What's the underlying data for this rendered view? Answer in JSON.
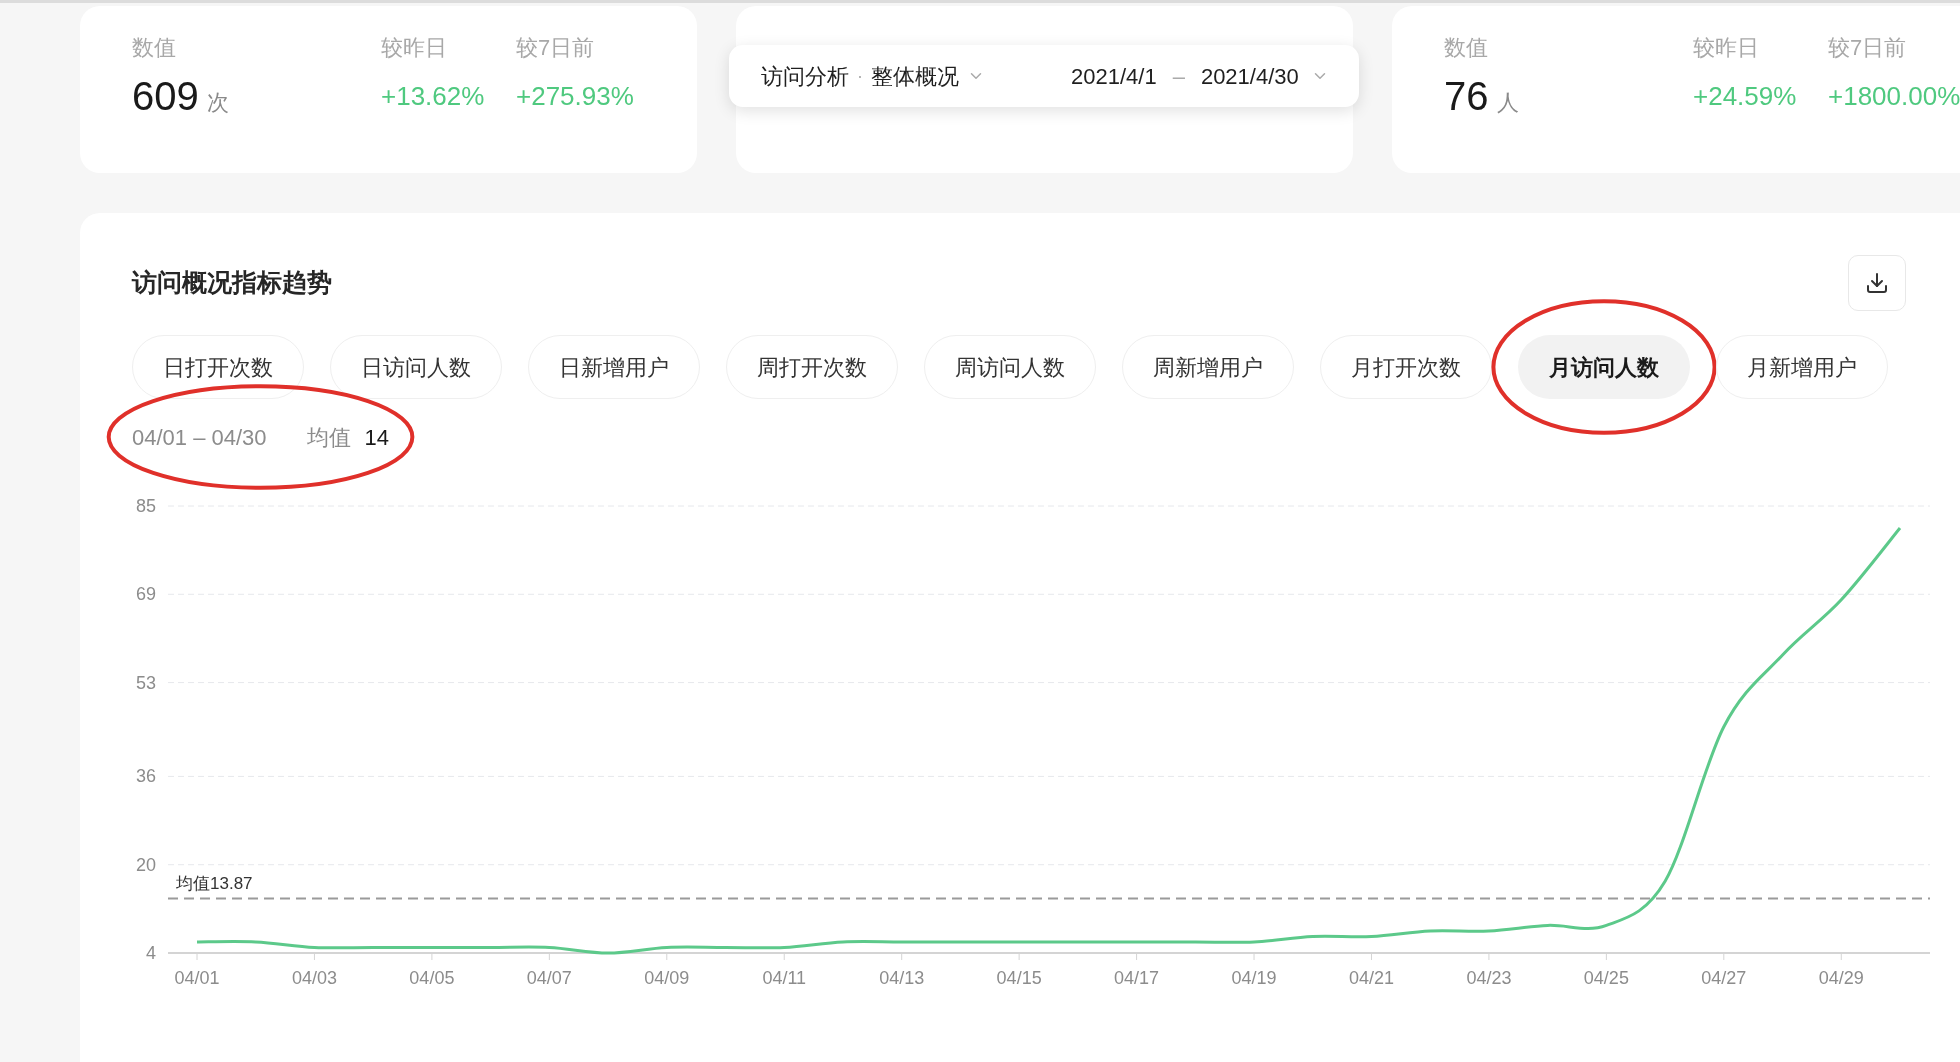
{
  "cards": [
    {
      "kind": "stat",
      "label": "数值",
      "value": "609",
      "unit": "次",
      "compare": [
        {
          "label": "较昨日",
          "value": "+13.62%"
        },
        {
          "label": "较7日前",
          "value": "+275.93%"
        }
      ]
    },
    {
      "kind": "covered"
    },
    {
      "kind": "stat",
      "label": "数值",
      "value": "76",
      "unit": "人",
      "compare": [
        {
          "label": "较昨日",
          "value": "+24.59%"
        },
        {
          "label": "较7日前",
          "value": "+1800.00%"
        }
      ]
    }
  ],
  "filter_bar": {
    "breadcrumb": [
      "访问分析",
      "整体概况"
    ],
    "breadcrumb_sep": "·",
    "date_start": "2021/4/1",
    "date_sep": "–",
    "date_end": "2021/4/30"
  },
  "trend": {
    "title": "访问概况指标趋势",
    "tabs": [
      {
        "label": "日打开次数",
        "selected": false,
        "circled": false
      },
      {
        "label": "日访问人数",
        "selected": false,
        "circled": false
      },
      {
        "label": "日新增用户",
        "selected": false,
        "circled": false
      },
      {
        "label": "周打开次数",
        "selected": false,
        "circled": false
      },
      {
        "label": "周访问人数",
        "selected": false,
        "circled": false
      },
      {
        "label": "周新增用户",
        "selected": false,
        "circled": false
      },
      {
        "label": "月打开次数",
        "selected": false,
        "circled": false
      },
      {
        "label": "月访问人数",
        "selected": true,
        "circled": true
      },
      {
        "label": "月新增用户",
        "selected": false,
        "circled": false
      }
    ],
    "range": "04/01 – 04/30",
    "avg_label": "均值",
    "avg_value": "14",
    "range_circled": true,
    "chart_data": {
      "type": "line",
      "categories": [
        "04/01",
        null,
        "04/03",
        null,
        "04/05",
        null,
        "04/07",
        null,
        "04/09",
        null,
        "04/11",
        null,
        "04/13",
        null,
        "04/15",
        null,
        "04/17",
        null,
        "04/19",
        null,
        "04/21",
        null,
        "04/23",
        null,
        "04/25",
        null,
        "04/27",
        null,
        "04/29",
        null
      ],
      "grid": true,
      "ylim": [
        4,
        85
      ],
      "yticks": [
        4,
        20,
        36,
        53,
        69,
        85
      ],
      "series": [
        {
          "color": "#5cc98a",
          "values": [
            6,
            6,
            5,
            5,
            5,
            5,
            5,
            4,
            5,
            5,
            5,
            6,
            6,
            6,
            6,
            6,
            6,
            6,
            6,
            7,
            7,
            8,
            8,
            9,
            9,
            17,
            45,
            58,
            68,
            81
          ]
        }
      ],
      "ref_lines": [
        {
          "axis": "y",
          "value": 13.87,
          "label": "均值13.87"
        }
      ]
    }
  }
}
